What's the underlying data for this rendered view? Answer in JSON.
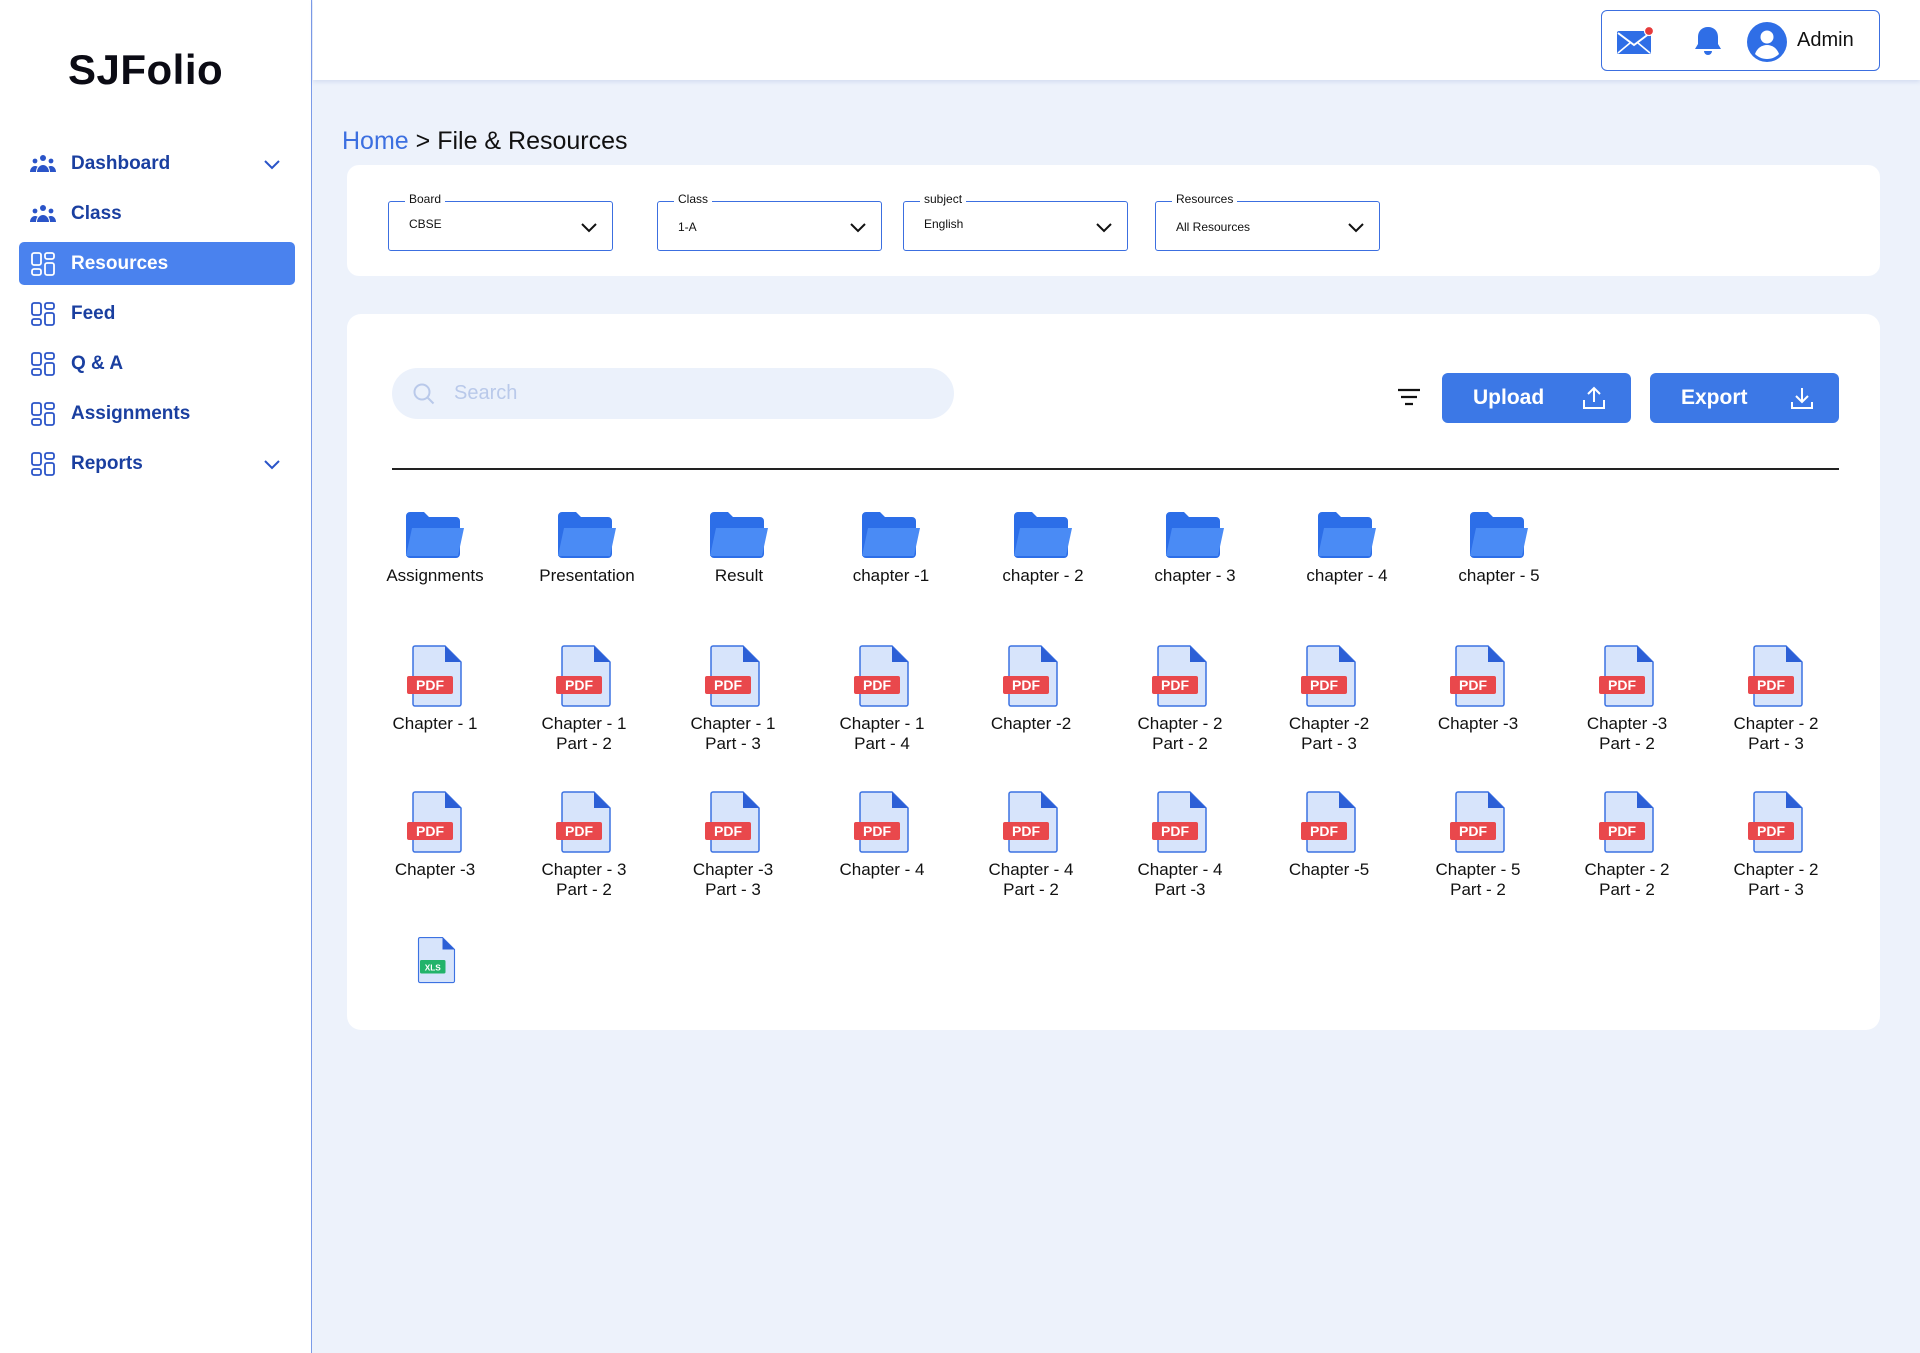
{
  "app": {
    "logo": "SJFolio"
  },
  "sidebar": {
    "items": [
      {
        "label": "Dashboard",
        "icon": "group-icon",
        "active": false,
        "expandable": true
      },
      {
        "label": "Class",
        "icon": "group-icon",
        "active": false,
        "expandable": false
      },
      {
        "label": "Resources",
        "icon": "grid-icon",
        "active": true,
        "expandable": false
      },
      {
        "label": "Feed",
        "icon": "grid-icon",
        "active": false,
        "expandable": false
      },
      {
        "label": "Q & A",
        "icon": "grid-icon",
        "active": false,
        "expandable": false
      },
      {
        "label": "Assignments",
        "icon": "grid-icon",
        "active": false,
        "expandable": false
      },
      {
        "label": "Reports",
        "icon": "grid-icon",
        "active": false,
        "expandable": true
      }
    ]
  },
  "header": {
    "user_name": "Admin",
    "mail_has_notification": true
  },
  "breadcrumb": {
    "home": "Home",
    "separator": " > ",
    "current": "File & Resources"
  },
  "filters": {
    "board": {
      "label": "Board",
      "value": "CBSE"
    },
    "class": {
      "label": "Class",
      "value": "1-A"
    },
    "subject": {
      "label": "subject",
      "value": "English"
    },
    "resources": {
      "label": "Resources",
      "value": "All Resources"
    }
  },
  "toolbar": {
    "search_placeholder": "Search",
    "upload_label": "Upload",
    "export_label": "Export"
  },
  "folders": [
    "Assignments",
    "Presentation",
    "Result",
    "chapter -1",
    "chapter - 2",
    "chapter - 3",
    "chapter - 4",
    "chapter - 5"
  ],
  "files": [
    {
      "name": "Chapter - 1",
      "type": "PDF"
    },
    {
      "name": "Chapter - 1\nPart - 2",
      "type": "PDF"
    },
    {
      "name": "Chapter - 1\nPart - 3",
      "type": "PDF"
    },
    {
      "name": "Chapter - 1\nPart - 4",
      "type": "PDF"
    },
    {
      "name": "Chapter -2",
      "type": "PDF"
    },
    {
      "name": "Chapter - 2\nPart - 2",
      "type": "PDF"
    },
    {
      "name": "Chapter -2\nPart - 3",
      "type": "PDF"
    },
    {
      "name": "Chapter -3",
      "type": "PDF"
    },
    {
      "name": "Chapter -3\nPart - 2",
      "type": "PDF"
    },
    {
      "name": "Chapter - 2\nPart - 3",
      "type": "PDF"
    },
    {
      "name": "Chapter -3",
      "type": "PDF"
    },
    {
      "name": "Chapter - 3\nPart - 2",
      "type": "PDF"
    },
    {
      "name": "Chapter -3\nPart - 3",
      "type": "PDF"
    },
    {
      "name": "Chapter - 4",
      "type": "PDF"
    },
    {
      "name": "Chapter - 4\nPart - 2",
      "type": "PDF"
    },
    {
      "name": "Chapter - 4\nPart -3",
      "type": "PDF"
    },
    {
      "name": "Chapter -5",
      "type": "PDF"
    },
    {
      "name": "Chapter - 5\nPart - 2",
      "type": "PDF"
    },
    {
      "name": "Chapter - 2\nPart - 2",
      "type": "PDF"
    },
    {
      "name": "Chapter - 2\nPart - 3",
      "type": "PDF"
    },
    {
      "name": "",
      "type": "XLS"
    }
  ],
  "colors": {
    "primary": "#3c78e6",
    "nav_text": "#1a3fa0",
    "folder": "#3c7cf0",
    "pdf_badge": "#e9484c",
    "xls_badge": "#22b36a",
    "page_bg": "#edf2fb"
  }
}
